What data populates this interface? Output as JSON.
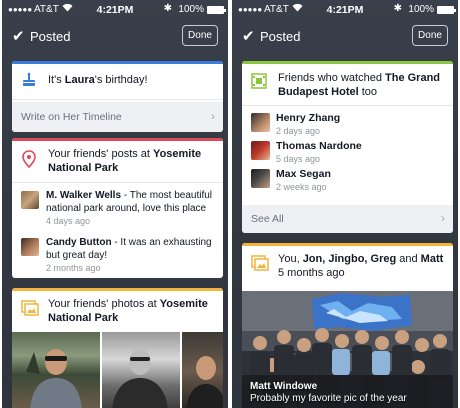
{
  "status": {
    "dots": "●●●●●",
    "carrier": "AT&T",
    "time": "4:21PM",
    "battery": "100%"
  },
  "topbar": {
    "posted": "Posted",
    "done": "Done"
  },
  "left": {
    "birthday": {
      "pre": "It's ",
      "name": "Laura",
      "post": "'s birthday!",
      "action": "Write on Her Timeline"
    },
    "posts_card": {
      "title_pre": "Your friends' posts at ",
      "title_place": "Yosemite National Park",
      "posts": [
        {
          "author": "M. Walker Wells",
          "text": " - The most beautiful national park around, love this place",
          "time": "4 days ago"
        },
        {
          "author": "Candy Button",
          "text": " - It was an exhausting but great day!",
          "time": "2 months ago"
        }
      ]
    },
    "photos_card": {
      "title_pre": "Your friends' photos at ",
      "title_place": "Yosemite National Park"
    }
  },
  "right": {
    "movie_card": {
      "title_pre": "Friends who watched ",
      "title_movie": "The Grand Budapest Hotel",
      "title_post": " too",
      "friends": [
        {
          "name": "Henry Zhang",
          "time": "2 days ago"
        },
        {
          "name": "Thomas Nardone",
          "time": "5 days ago"
        },
        {
          "name": "Max Segan",
          "time": "2 weeks ago"
        }
      ],
      "see_all": "See All"
    },
    "group_card": {
      "title_pre": "You, ",
      "title_names": "Jon, Jingbo, Greg",
      "title_and": " and ",
      "title_last": "Matt",
      "time": "5 months ago",
      "caption_name": "Matt Windowe",
      "caption_text": "Probably my favorite pic of the year"
    }
  },
  "colors": {
    "birthday_accent": "#3b7be0",
    "posts_accent": "#e0495a",
    "photos_accent": "#f2b33d",
    "movie_accent": "#8cc63f",
    "group_accent": "#f2b33d"
  }
}
